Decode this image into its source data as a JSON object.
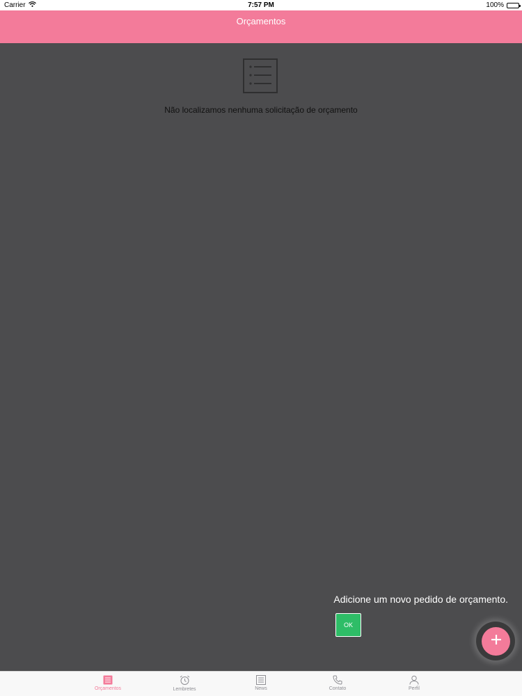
{
  "status_bar": {
    "carrier": "Carrier",
    "time": "7:57 PM",
    "battery": "100%"
  },
  "nav": {
    "title": "Orçamentos"
  },
  "empty_state": {
    "icon": "list-icon",
    "message": "Não localizamos nenhuma solicitação de orçamento"
  },
  "coach_mark": {
    "text": "Adicione um novo pedido de orçamento.",
    "ok_label": "OK"
  },
  "fab": {
    "icon": "plus-icon"
  },
  "tabs": [
    {
      "label": "Orçamentos",
      "icon": "list-icon",
      "active": true
    },
    {
      "label": "Lembretes",
      "icon": "alarm-clock-icon",
      "active": false
    },
    {
      "label": "News",
      "icon": "newspaper-icon",
      "active": false
    },
    {
      "label": "Contato",
      "icon": "phone-icon",
      "active": false
    },
    {
      "label": "Perfil",
      "icon": "user-icon",
      "active": false
    }
  ],
  "colors": {
    "accent": "#f37b9a",
    "overlay": "#4c4c4e",
    "ok_button": "#2ebd67",
    "tab_inactive": "#8e8e93"
  }
}
